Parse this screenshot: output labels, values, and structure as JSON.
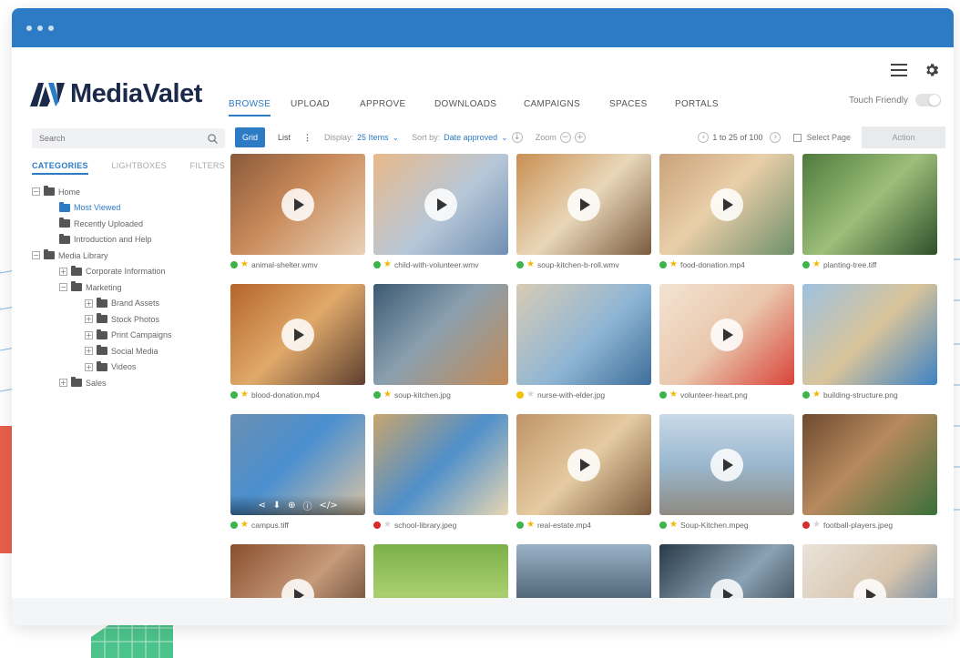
{
  "brand": {
    "name": "MediaValet",
    "accent": "#2c7bc4",
    "titlebar_color": "#2c7bc4"
  },
  "top_icons": [
    "hamburger-menu-icon",
    "gear-icon"
  ],
  "nav": {
    "items": [
      {
        "label": "BROWSE",
        "active": true
      },
      {
        "label": "UPLOAD",
        "active": false
      },
      {
        "label": "APPROVE",
        "active": false
      },
      {
        "label": "DOWNLOADS",
        "active": false
      },
      {
        "label": "CAMPAIGNS",
        "active": false
      },
      {
        "label": "SPACES",
        "active": false
      },
      {
        "label": "PORTALS",
        "active": false
      }
    ],
    "touch_label": "Touch Friendly",
    "touch_enabled": false
  },
  "sidebar": {
    "search_placeholder": "Search",
    "tabs": [
      "CATEGORIES",
      "LIGHTBOXES",
      "FILTERS"
    ],
    "tree": [
      {
        "label": "Home",
        "toggle": "−",
        "level": 0
      },
      {
        "label": "Most Viewed",
        "toggle": "",
        "level": 1,
        "selected": true
      },
      {
        "label": "Recently Uploaded",
        "toggle": "",
        "level": 1
      },
      {
        "label": "Introduction and Help",
        "toggle": "",
        "level": 1
      },
      {
        "label": "Media Library",
        "toggle": "−",
        "level": 0
      },
      {
        "label": "Corporate Information",
        "toggle": "+",
        "level": 1
      },
      {
        "label": "Marketing",
        "toggle": "−",
        "level": 1
      },
      {
        "label": "Brand Assets",
        "toggle": "+",
        "level": 2
      },
      {
        "label": "Stock Photos",
        "toggle": "+",
        "level": 2
      },
      {
        "label": "Print Campaigns",
        "toggle": "+",
        "level": 2
      },
      {
        "label": "Social Media",
        "toggle": "+",
        "level": 2
      },
      {
        "label": "Videos",
        "toggle": "+",
        "level": 2
      },
      {
        "label": "Sales",
        "toggle": "+",
        "level": 1
      }
    ]
  },
  "toolbar": {
    "grid_label": "Grid",
    "list_label": "List",
    "display_label": "Display:",
    "display_value": "25 Items",
    "sort_label": "Sort by:",
    "sort_value": "Date approved",
    "zoom_label": "Zoom",
    "range_text": "1 to 25 of 100",
    "select_page_label": "Select Page",
    "action_label": "Action"
  },
  "assets": [
    {
      "name": "animal-shelter.wmv",
      "status": "#3bb54a",
      "starred": true,
      "video": true,
      "bg": "linear-gradient(135deg,#8a5a3b 0%,#c98a5a 45%,#e9d2b8 100%)"
    },
    {
      "name": "child-with-volunteer.wmv",
      "status": "#3bb54a",
      "starred": true,
      "video": true,
      "bg": "linear-gradient(135deg,#e8b98a 0%,#b7c7d8 55%,#6f8fb2 100%)"
    },
    {
      "name": "soup-kitchen-b-roll.wmv",
      "status": "#3bb54a",
      "starred": true,
      "video": true,
      "bg": "linear-gradient(135deg,#c98f52 0%,#e9d7b9 50%,#7a5a3e 100%)"
    },
    {
      "name": "food-donation.mp4",
      "status": "#3bb54a",
      "starred": true,
      "video": true,
      "bg": "linear-gradient(135deg,#c9a27a 0%,#e9cfa9 45%,#6e8f6a 100%)"
    },
    {
      "name": "planting-tree.tiff",
      "status": "#3bb54a",
      "starred": true,
      "video": false,
      "bg": "linear-gradient(135deg,#4f7a3c 0%,#9cbf7a 50%,#2f4f2a 100%)"
    },
    {
      "name": "blood-donation.mp4",
      "status": "#3bb54a",
      "starred": true,
      "video": true,
      "bg": "linear-gradient(135deg,#b5652a 0%,#e0a96a 50%,#5e4030 100%)"
    },
    {
      "name": "soup-kitchen.jpg",
      "status": "#3bb54a",
      "starred": true,
      "video": false,
      "bg": "linear-gradient(135deg,#3d5a73 0%,#8aa0b0 45%,#c38a55 100%)"
    },
    {
      "name": "nurse-with-elder.jpg",
      "status": "#f2c200",
      "starred": false,
      "video": false,
      "bg": "linear-gradient(135deg,#d8cbb5 0%,#8fb6d4 55%,#3e6e9a 100%)"
    },
    {
      "name": "volunteer-heart.png",
      "status": "#3bb54a",
      "starred": true,
      "video": true,
      "bg": "linear-gradient(135deg,#f3e3d3 0%,#e9c7ac 50%,#d9433a 100%)"
    },
    {
      "name": "building-structure.png",
      "status": "#3bb54a",
      "starred": true,
      "video": false,
      "bg": "linear-gradient(135deg,#9ec1df 0%,#d9c49a 50%,#3d82c4 100%)"
    },
    {
      "name": "campus.tiff",
      "status": "#3bb54a",
      "starred": true,
      "video": false,
      "hover": true,
      "bg": "linear-gradient(135deg,#6a8fb3 0%,#4a8fcf 45%,#d9c3a5 100%)"
    },
    {
      "name": "school-library.jpeg",
      "status": "#d92b2b",
      "starred": false,
      "video": false,
      "bg": "linear-gradient(135deg,#c9a56e 0%,#4f8fca 50%,#e8d6b2 100%)"
    },
    {
      "name": "real-estate.mp4",
      "status": "#3bb54a",
      "starred": true,
      "video": true,
      "bg": "linear-gradient(135deg,#bf9466 0%,#e6cba2 50%,#7a5a3c 100%)"
    },
    {
      "name": "Soup-Kitchen.mpeg",
      "status": "#3bb54a",
      "starred": true,
      "video": true,
      "bg": "linear-gradient(180deg,#c9d9e8 0%,#9ab8cf 50%,#8e8a82 100%)"
    },
    {
      "name": "football-players.jpeg",
      "status": "#d92b2b",
      "starred": false,
      "video": false,
      "bg": "linear-gradient(135deg,#6e4a30 0%,#b88a5e 45%,#3a6f3a 100%)"
    },
    {
      "name": "",
      "status": "",
      "starred": false,
      "video": true,
      "bg": "linear-gradient(135deg,#8a4f2e 0%,#c69a7a 50%,#4a3020 100%)"
    },
    {
      "name": "",
      "status": "",
      "starred": false,
      "video": false,
      "bg": "linear-gradient(180deg,#7bb04a 0%,#a9cf6f 50%,#5e9a3a 100%)"
    },
    {
      "name": "",
      "status": "",
      "starred": false,
      "video": false,
      "bg": "linear-gradient(180deg,#9bb3c7 0%,#4f6477 55%,#2b3a47 100%)"
    },
    {
      "name": "",
      "status": "",
      "starred": false,
      "video": true,
      "bg": "linear-gradient(135deg,#2a3a48 0%,#8aa2b4 50%,#1f2a33 100%)"
    },
    {
      "name": "",
      "status": "",
      "starred": false,
      "video": true,
      "bg": "linear-gradient(135deg,#e9e3da 0%,#d7c4ad 50%,#3d6e9e 100%)"
    }
  ],
  "hover_actions": [
    "share-icon",
    "download-icon",
    "add-icon",
    "info-icon",
    "embed-icon"
  ],
  "hover_glyphs": [
    "⋖",
    "⬇",
    "⊕",
    "ⓘ",
    "</>"
  ]
}
